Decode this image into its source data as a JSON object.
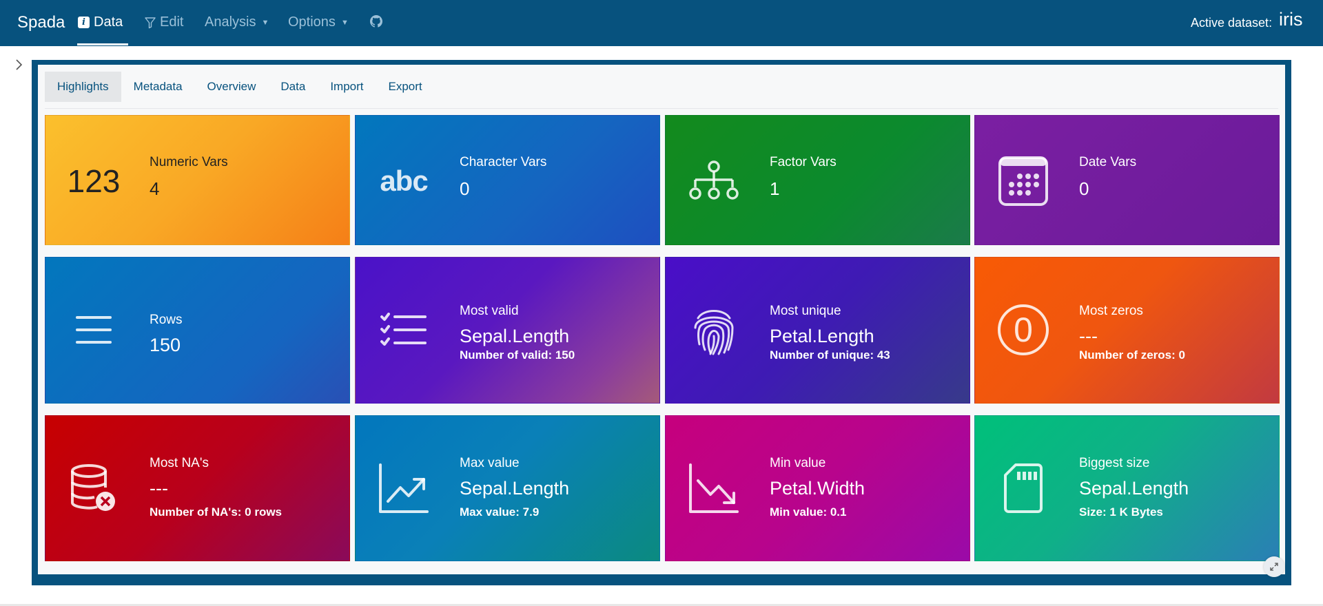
{
  "navbar": {
    "brand": "Spada",
    "items": [
      {
        "label": "Data",
        "icon": "info-icon",
        "active": true
      },
      {
        "label": "Edit",
        "icon": "filter-icon"
      },
      {
        "label": "Analysis",
        "dropdown": true
      },
      {
        "label": "Options",
        "dropdown": true
      },
      {
        "label": "",
        "icon": "github-icon"
      }
    ],
    "active_dataset_label": "Active dataset:",
    "active_dataset_value": "iris"
  },
  "tabs": [
    "Highlights",
    "Metadata",
    "Overview",
    "Data",
    "Import",
    "Export"
  ],
  "active_tab": "Highlights",
  "cards": {
    "numeric": {
      "icon_text": "123",
      "title": "Numeric Vars",
      "value": "4"
    },
    "character": {
      "icon_text": "abc",
      "title": "Character Vars",
      "value": "0"
    },
    "factor": {
      "icon": "sitemap-icon",
      "title": "Factor Vars",
      "value": "1"
    },
    "date": {
      "icon": "calendar-icon",
      "title": "Date Vars",
      "value": "0"
    },
    "rows": {
      "icon": "lines-icon",
      "title": "Rows",
      "value": "150"
    },
    "valid": {
      "icon": "list-check-icon",
      "title": "Most valid",
      "value": "Sepal.Length",
      "detail": "Number of valid: 150"
    },
    "unique": {
      "icon": "fingerprint-icon",
      "title": "Most unique",
      "value": "Petal.Length",
      "detail": "Number of unique: 43"
    },
    "zeros": {
      "icon_text": "0",
      "title": "Most zeros",
      "value": "---",
      "detail": "Number of zeros: 0"
    },
    "na": {
      "icon": "database-x-icon",
      "title": "Most NA's",
      "value": "---",
      "detail": "Number of NA's: 0 rows"
    },
    "max": {
      "icon": "chart-up-icon",
      "title": "Max value",
      "value": "Sepal.Length",
      "detail": "Max value: 7.9"
    },
    "min": {
      "icon": "chart-down-icon",
      "title": "Min value",
      "value": "Petal.Width",
      "detail": "Min value: 0.1"
    },
    "size": {
      "icon": "sd-card-icon",
      "title": "Biggest size",
      "value": "Sepal.Length",
      "detail": "Size: 1 K Bytes"
    }
  },
  "colors": {
    "navbar": "#07527e",
    "tab_text": "#07527e"
  }
}
